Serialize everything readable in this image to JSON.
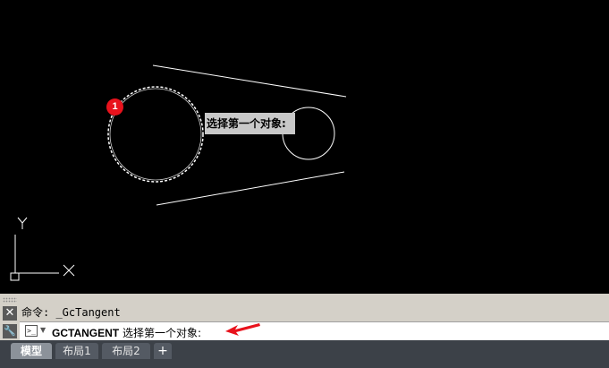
{
  "canvas": {
    "tooltip_text": "选择第一个对象:",
    "badge_number": "1",
    "ucs_x_label": "X",
    "ucs_y_label": "Y"
  },
  "command_panel": {
    "history_text": "命令: _GcTangent",
    "prompt_icon": ">_",
    "command_name": "GCTANGENT",
    "command_prompt": "选择第一个对象:",
    "close_icon": "close-icon",
    "settings_icon": "wrench-icon"
  },
  "tabs": [
    {
      "label": "模型",
      "active": true
    },
    {
      "label": "布局1",
      "active": false
    },
    {
      "label": "布局2",
      "active": false
    }
  ],
  "add_tab_label": "+",
  "colors": {
    "canvas_bg": "#000000",
    "tooltip_bg": "#c8c8c8",
    "badge": "#e8121c",
    "arrow": "#e8121c"
  }
}
